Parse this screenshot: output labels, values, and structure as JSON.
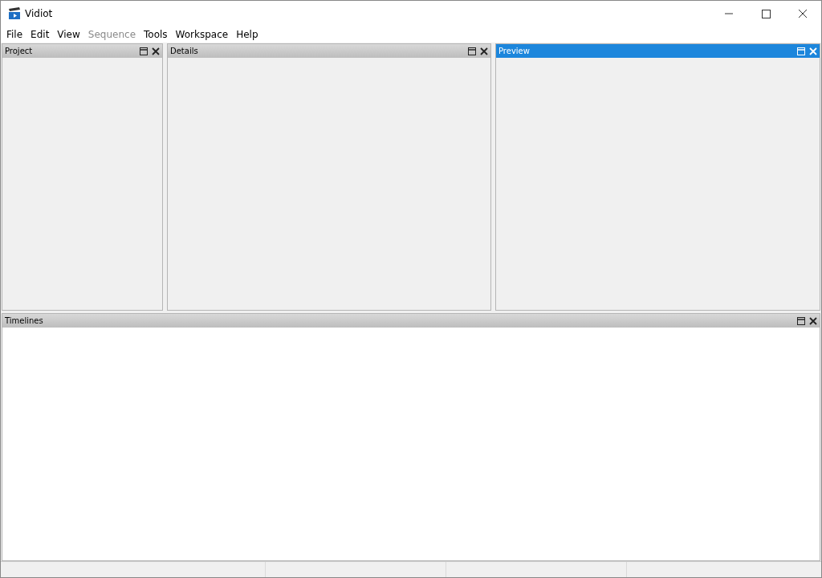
{
  "window": {
    "title": "Vidiot"
  },
  "menu": [
    {
      "label": "File",
      "disabled": false
    },
    {
      "label": "Edit",
      "disabled": false
    },
    {
      "label": "View",
      "disabled": false
    },
    {
      "label": "Sequence",
      "disabled": true
    },
    {
      "label": "Tools",
      "disabled": false
    },
    {
      "label": "Workspace",
      "disabled": false
    },
    {
      "label": "Help",
      "disabled": false
    }
  ],
  "top_panes": [
    {
      "title": "Project",
      "selected": false
    },
    {
      "title": "Details",
      "selected": false
    },
    {
      "title": "Preview",
      "selected": true
    }
  ],
  "bottom_pane": {
    "title": "Timelines",
    "selected": false
  }
}
